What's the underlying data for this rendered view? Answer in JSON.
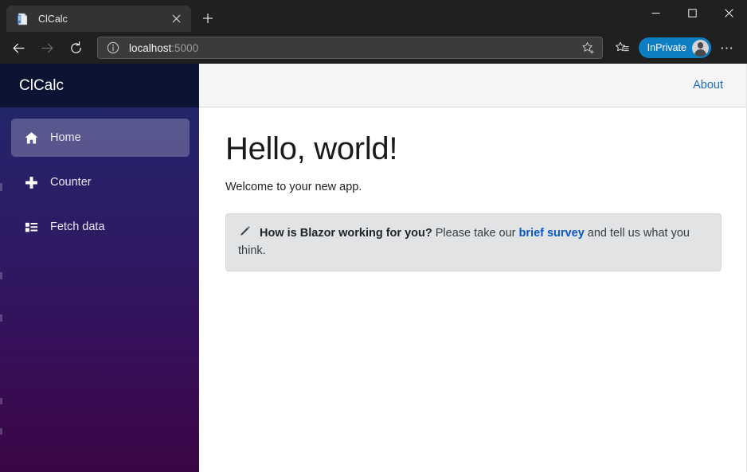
{
  "browser": {
    "tab": {
      "title": "ClCalc",
      "favicon_icon": "document-icon",
      "close_icon": "close-icon"
    },
    "newtab_icon": "plus-icon",
    "window_controls": {
      "minimize_icon": "minimize-icon",
      "maximize_icon": "maximize-icon",
      "close_icon": "close-icon"
    },
    "nav": {
      "back_icon": "arrow-left-icon",
      "forward_icon": "arrow-right-icon",
      "reload_icon": "reload-icon"
    },
    "address_bar": {
      "info_icon": "info-circle-icon",
      "url_host": "localhost",
      "url_port": ":5000",
      "placeholder": "Search or enter web address",
      "favorite_icon": "star-plus-icon"
    },
    "collections_icon": "star-list-icon",
    "profile": {
      "label": "InPrivate",
      "avatar_icon": "person-avatar-icon",
      "color": "#0d7ec4"
    },
    "settings_icon": "ellipsis-icon"
  },
  "page": {
    "brand": "ClCalc",
    "sidebar": {
      "items": [
        {
          "label": "Home",
          "icon": "home-icon",
          "active": true
        },
        {
          "label": "Counter",
          "icon": "plus-icon",
          "active": false
        },
        {
          "label": "Fetch data",
          "icon": "list-icon",
          "active": false
        }
      ],
      "gradient_from": "#1b2a6b",
      "gradient_to": "#3b0645",
      "brand_bg": "#0b1533"
    },
    "topbar": {
      "about_label": "About",
      "link_color": "#1b6ec2"
    },
    "main": {
      "heading": "Hello, world!",
      "lead": "Welcome to your new app.",
      "alert": {
        "icon": "pencil-icon",
        "bold_text": "How is Blazor working for you?",
        "text_before_link": " Please take our ",
        "link_text": "brief survey",
        "text_after_link": " and tell us what you think.",
        "bg": "#e2e3e5",
        "link_color": "#0a58ca"
      }
    }
  }
}
